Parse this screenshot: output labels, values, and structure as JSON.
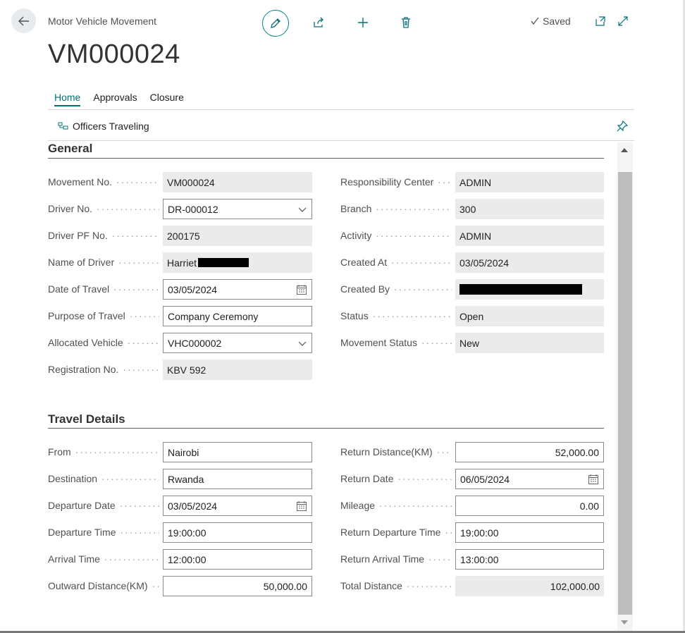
{
  "header": {
    "subtitle": "Motor Vehicle Movement",
    "title": "VM000024",
    "saved_label": "Saved"
  },
  "tabs": [
    {
      "label": "Home",
      "active": true
    },
    {
      "label": "Approvals",
      "active": false
    },
    {
      "label": "Closure",
      "active": false
    }
  ],
  "actions": {
    "officers_traveling": "Officers Traveling"
  },
  "general": {
    "title": "General",
    "left": [
      {
        "label": "Movement No.",
        "value": "VM000024",
        "kind": "readonly"
      },
      {
        "label": "Driver No.",
        "value": "DR-000012",
        "kind": "dropdown"
      },
      {
        "label": "Driver PF No.",
        "value": "200175",
        "kind": "readonly"
      },
      {
        "label": "Name of Driver",
        "value": "Harriet",
        "kind": "readonly-redacted"
      },
      {
        "label": "Date of Travel",
        "value": "03/05/2024",
        "kind": "date"
      },
      {
        "label": "Purpose of Travel",
        "value": "Company Ceremony",
        "kind": "text"
      },
      {
        "label": "Allocated Vehicle",
        "value": "VHC000002",
        "kind": "dropdown"
      },
      {
        "label": "Registration No.",
        "value": "KBV 592",
        "kind": "readonly"
      }
    ],
    "right": [
      {
        "label": "Responsibility Center",
        "value": "ADMIN",
        "kind": "readonly"
      },
      {
        "label": "Branch",
        "value": "300",
        "kind": "readonly"
      },
      {
        "label": "Activity",
        "value": "ADMIN",
        "kind": "readonly"
      },
      {
        "label": "Created At",
        "value": "03/05/2024",
        "kind": "readonly"
      },
      {
        "label": "Created By",
        "value": "",
        "kind": "readonly-redacted"
      },
      {
        "label": "Status",
        "value": "Open",
        "kind": "readonly"
      },
      {
        "label": "Movement Status",
        "value": "New",
        "kind": "readonly"
      }
    ]
  },
  "travel": {
    "title": "Travel Details",
    "left": [
      {
        "label": "From",
        "value": "Nairobi",
        "kind": "text"
      },
      {
        "label": "Destination",
        "value": "Rwanda",
        "kind": "text"
      },
      {
        "label": "Departure Date",
        "value": "03/05/2024",
        "kind": "date"
      },
      {
        "label": "Departure Time",
        "value": "19:00:00",
        "kind": "text"
      },
      {
        "label": "Arrival Time",
        "value": "12:00:00",
        "kind": "text"
      },
      {
        "label": "Outward Distance(KM)",
        "value": "50,000.00",
        "kind": "number"
      }
    ],
    "right": [
      {
        "label": "Return Distance(KM)",
        "value": "52,000.00",
        "kind": "number"
      },
      {
        "label": "Return Date",
        "value": "06/05/2024",
        "kind": "date"
      },
      {
        "label": "Mileage",
        "value": "0.00",
        "kind": "number"
      },
      {
        "label": "Return Departure Time",
        "value": "19:00:00",
        "kind": "text"
      },
      {
        "label": "Return Arrival Time",
        "value": "13:00:00",
        "kind": "text"
      },
      {
        "label": "Total Distance",
        "value": "102,000.00",
        "kind": "readonly-number"
      }
    ]
  },
  "colors": {
    "accent": "#00707a",
    "readonly_bg": "#eaebec"
  },
  "icons": [
    "back-arrow-icon",
    "pencil-icon",
    "share-icon",
    "plus-icon",
    "trash-icon",
    "checkmark-icon",
    "open-new-window-icon",
    "expand-icon",
    "officers-icon",
    "pin-icon",
    "calendar-icon",
    "chevron-down-icon"
  ]
}
